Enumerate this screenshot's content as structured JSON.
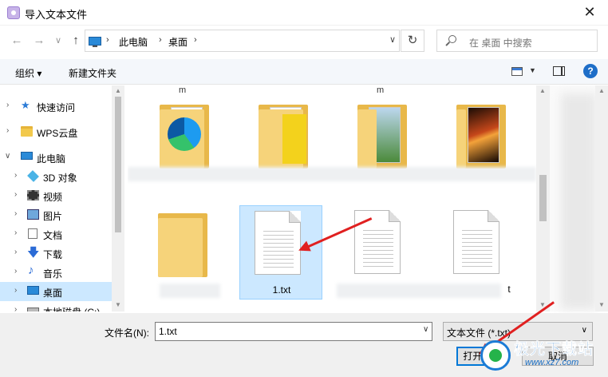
{
  "window": {
    "title": "导入文本文件",
    "close_glyph": "✕"
  },
  "nav": {
    "back": "←",
    "forward": "→",
    "recent": "∨",
    "up": "↑",
    "breadcrumb": [
      "此电脑",
      "桌面"
    ],
    "refresh": "↻",
    "search_placeholder": "在 桌面 中搜索"
  },
  "toolbar": {
    "organize": "组织 ▾",
    "new_folder": "新建文件夹",
    "help": "?"
  },
  "sidebar": {
    "items": [
      {
        "label": "快速访问",
        "icon": "star-icon"
      },
      {
        "label": "WPS云盘",
        "icon": "folder-icon"
      },
      {
        "label": "此电脑",
        "icon": "pc-icon"
      },
      {
        "label": "3D 对象",
        "icon": "cube-icon"
      },
      {
        "label": "视频",
        "icon": "film-icon"
      },
      {
        "label": "图片",
        "icon": "picture-icon"
      },
      {
        "label": "文档",
        "icon": "document-icon"
      },
      {
        "label": "下载",
        "icon": "download-icon"
      },
      {
        "label": "音乐",
        "icon": "music-icon"
      },
      {
        "label": "桌面",
        "icon": "desktop-icon"
      },
      {
        "label": "本地磁盘 (C:)",
        "icon": "disk-icon"
      }
    ]
  },
  "content": {
    "truncated_labels": [
      "m",
      "m"
    ],
    "row1": [
      {
        "type": "folder",
        "preview": "edge-logo"
      },
      {
        "type": "folder",
        "preview": "yellow-document"
      },
      {
        "type": "folder",
        "preview": "landscape-photo"
      },
      {
        "type": "folder",
        "preview": "fire-artwork"
      }
    ],
    "row2": [
      {
        "type": "folder",
        "name": ""
      },
      {
        "type": "txt",
        "name": "1.txt",
        "selected": true
      },
      {
        "type": "txt",
        "name": ""
      },
      {
        "type": "txt",
        "name": "t"
      }
    ]
  },
  "bottom": {
    "filename_label": "文件名(N):",
    "filename_value": "1.txt",
    "filetype": "文本文件 (*.txt)",
    "open_button": "打开(O)",
    "cancel_button": "取消"
  },
  "watermark": {
    "text": "极光下载站",
    "url": "www.xz7.com"
  },
  "colors": {
    "accent": "#0078d7",
    "selected_bg": "#cce8ff",
    "arrow": "#e02020"
  }
}
